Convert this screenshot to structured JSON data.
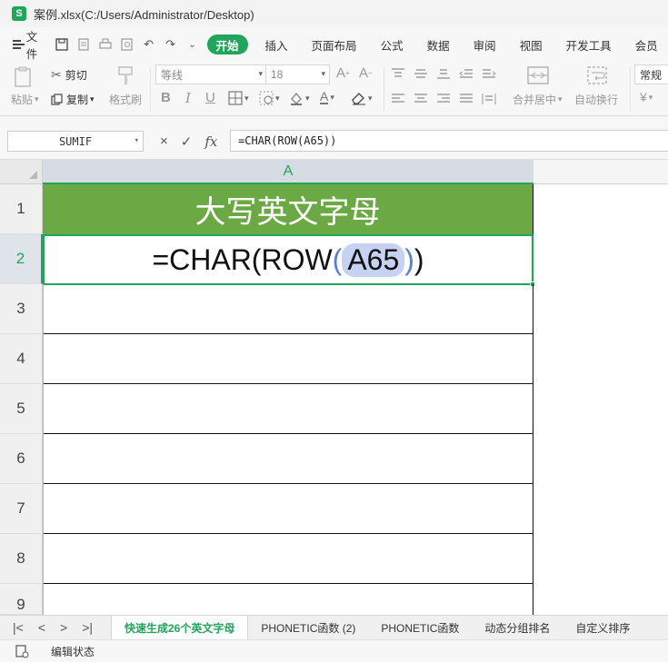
{
  "window": {
    "title": "案例.xlsx(C:/Users/Administrator/Desktop)",
    "logo": "S"
  },
  "menu": {
    "file_label": "文件",
    "tabs": [
      "开始",
      "插入",
      "页面布局",
      "公式",
      "数据",
      "审阅",
      "视图",
      "开发工具",
      "会员"
    ],
    "active_tab": "开始"
  },
  "ribbon": {
    "paste_label": "粘贴",
    "cut_label": "剪切",
    "copy_label": "复制",
    "format_painter_label": "格式刷",
    "font_name": "等线",
    "font_size": "18",
    "merge_label": "合并居中",
    "wrap_label": "自动换行",
    "number_format": "常规",
    "currency_symbol": "¥"
  },
  "formula_bar": {
    "name_box": "SUMIF",
    "cancel_icon": "×",
    "confirm_icon": "✓",
    "fx_label": "fx",
    "formula": "=CHAR(ROW(A65))"
  },
  "grid": {
    "column_header": "A",
    "rows": [
      "1",
      "2",
      "3",
      "4",
      "5",
      "6",
      "7",
      "8",
      "9"
    ],
    "header_cell": "大写英文字母",
    "editing": {
      "prefix": "=CHAR(ROW",
      "open_paren": "(",
      "ref": "A65",
      "close_paren": ")",
      "suffix": ")"
    },
    "colors": {
      "header_fill": "#6aa943",
      "accent": "#1fa65a",
      "ref_highlight": "#c6d2f1"
    }
  },
  "sheets": {
    "tabs": [
      "快速生成26个英文字母",
      "PHONETIC函数 (2)",
      "PHONETIC函数",
      "动态分组排名",
      "自定义排序"
    ],
    "active": "快速生成26个英文字母"
  },
  "status": {
    "mode": "编辑状态"
  }
}
